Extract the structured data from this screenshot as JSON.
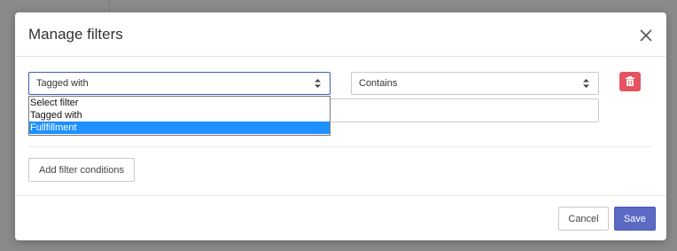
{
  "modal": {
    "title": "Manage filters"
  },
  "filter_row": {
    "filter_select": {
      "selected": "Tagged with"
    },
    "operator_select": {
      "selected": "Contains"
    },
    "value_input": {
      "value": ""
    }
  },
  "dropdown": {
    "options": [
      "Select filter",
      "Tagged with",
      "Fullfillment"
    ],
    "highlighted": "Fullfillment"
  },
  "actions": {
    "add_filter_label": "Add filter conditions",
    "cancel_label": "Cancel",
    "save_label": "Save"
  },
  "colors": {
    "primary": "#5c6ac4",
    "danger": "#e55361",
    "dropdown_highlight": "#1e90ff",
    "focus_border": "#3f5cbf"
  },
  "icons": [
    "close-icon",
    "select-arrows-icon",
    "trash-icon"
  ]
}
